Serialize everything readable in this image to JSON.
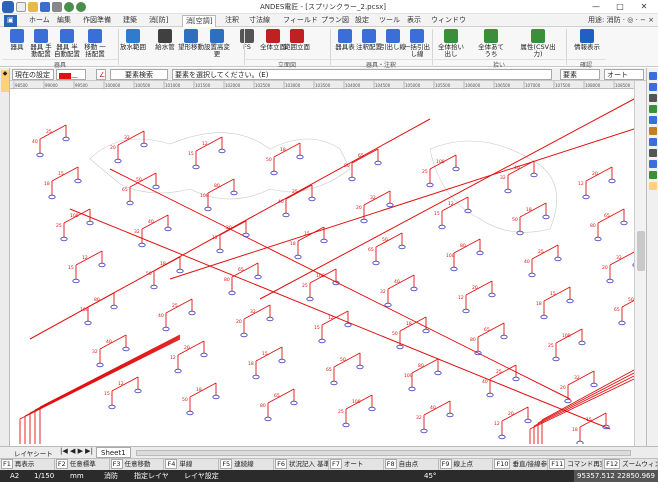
{
  "window": {
    "title": "ANDES電匠 - [スプリンクラー_2.pcsx]",
    "min": "—",
    "max": "□",
    "close": "✕"
  },
  "menu": {
    "tabs": [
      "ホーム",
      "編集",
      "作図準備",
      "建築",
      "消[防]",
      "消[空調]",
      "注釈",
      "寸法線",
      "フィールド",
      "プラン図",
      "設定",
      "ツール",
      "表示",
      "ウィンドウ"
    ],
    "active": "消[空調]",
    "context": "用途: 消防 · ◎ · − ×"
  },
  "ribbon": {
    "buttons": [
      {
        "label": "器具",
        "icon": "fixture-icon",
        "color": "#3a6fd8"
      },
      {
        "label": "器具 手動配置",
        "icon": "fixture-manual-icon",
        "color": "#3a6fd8"
      },
      {
        "label": "器具 半自動配置",
        "icon": "fixture-semiauto-icon",
        "color": "#3a6fd8"
      },
      {
        "label": "移動 一括配置",
        "icon": "move-batch-icon",
        "color": "#3a6fd8"
      },
      {
        "label": "放水範囲",
        "icon": "spray-range-icon",
        "color": "#2e7bd0"
      },
      {
        "label": "給水管",
        "icon": "pipe-icon",
        "color": "#404040"
      },
      {
        "label": "望形移動",
        "icon": "shape-move-icon",
        "color": "#2f6fbf"
      },
      {
        "label": "設置高変更",
        "icon": "height-change-icon",
        "color": "#2f6fbf"
      },
      {
        "label": "FS",
        "icon": "fs-icon",
        "color": "#555555"
      },
      {
        "label": "全体立面",
        "icon": "elevation-all-icon",
        "color": "#c02020"
      },
      {
        "label": "範囲立面",
        "icon": "elevation-range-icon",
        "color": "#c02020"
      },
      {
        "label": "器具表",
        "icon": "table-icon",
        "color": "#3a6fd8"
      },
      {
        "label": "注釈配置",
        "icon": "annotation-icon",
        "color": "#3a6fd8"
      },
      {
        "label": "引出し線",
        "icon": "leader-icon",
        "color": "#3a6fd8"
      },
      {
        "label": "一括引出し線",
        "icon": "batch-leader-icon",
        "color": "#3a6fd8"
      },
      {
        "label": "全体拾い出し",
        "icon": "takeoff-all-icon",
        "color": "#3a8f3a"
      },
      {
        "label": "全体あてうち",
        "icon": "check-all-icon",
        "color": "#3a8f3a"
      },
      {
        "label": "属性(CSV出力)",
        "icon": "csv-icon",
        "color": "#3a8f3a"
      },
      {
        "label": "情報表示",
        "icon": "info-icon",
        "color": "#2060c0"
      }
    ],
    "groups": [
      "器具",
      "立面図",
      "器具・注釈",
      "拾い",
      "確認"
    ]
  },
  "propbar": {
    "current_setting": "現在の設定",
    "element_search": "要素検索",
    "prompt": "要素を選択してください。(E)",
    "dropdown1": "要素",
    "dropdown2": "オート"
  },
  "ruler": {
    "ticks": [
      "98500",
      "99000",
      "99500",
      "100000",
      "100500",
      "101000",
      "101500",
      "102000",
      "102500",
      "103000",
      "103500",
      "104000",
      "104500",
      "105000",
      "105500",
      "106000",
      "106500",
      "107000",
      "107500",
      "108000",
      "108500"
    ]
  },
  "sheet": {
    "tab": "Sheet1",
    "layer": "レイヤシート"
  },
  "fkeys": [
    {
      "key": "F1",
      "label": "再表示"
    },
    {
      "key": "F2",
      "label": "任意標準"
    },
    {
      "key": "F3",
      "label": "任意移動"
    },
    {
      "key": "F4",
      "label": "単線"
    },
    {
      "key": "F5",
      "label": "連続線"
    },
    {
      "key": "F6",
      "label": "状況記入 基準強"
    },
    {
      "key": "F7",
      "label": "オート"
    },
    {
      "key": "F8",
      "label": "自由点"
    },
    {
      "key": "F9",
      "label": "線上点"
    },
    {
      "key": "F10",
      "label": "垂直/接線参照"
    },
    {
      "key": "F11",
      "label": "コマンド再実行"
    },
    {
      "key": "F12",
      "label": "ズームウィンドウ"
    }
  ],
  "status": {
    "paper": "A2",
    "scale": "1/150",
    "unit": "mm",
    "layer_group": "消防",
    "layer_label": "指定レイヤ",
    "layer_setting": "レイヤ設定",
    "angle": "45°",
    "coords": "95357.512  22850.969"
  },
  "drawing": {
    "pipe_color": "#e01010",
    "labels": [
      "25",
      "40",
      "32",
      "20",
      "12",
      "15",
      "18",
      "50",
      "65",
      "80",
      "100"
    ]
  }
}
